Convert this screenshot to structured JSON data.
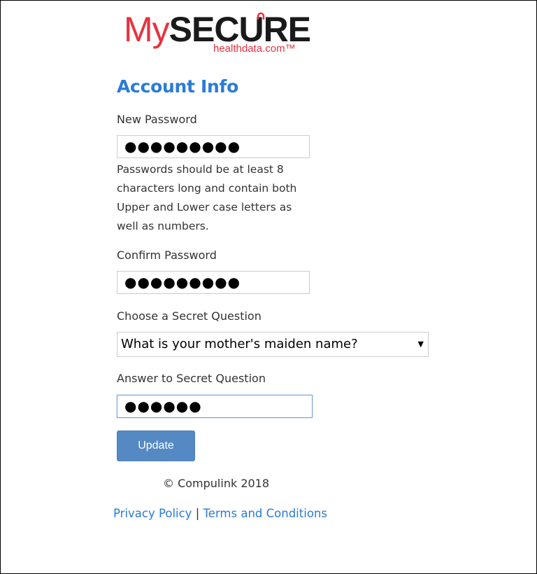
{
  "logo": {
    "part1": "My",
    "part2": "SECURE",
    "tagline": "healthdata.com™",
    "colors": {
      "red": "#e8323f",
      "dark": "#1a1a1a"
    }
  },
  "form": {
    "title": "Account Info",
    "new_password": {
      "label": "New Password",
      "value": "●●●●●●●●●"
    },
    "hint": "Passwords should be at least 8 characters long and contain both Upper and Lower case letters as well as numbers.",
    "confirm_password": {
      "label": "Confirm Password",
      "value": "●●●●●●●●●"
    },
    "secret_question": {
      "label": "Choose a Secret Question",
      "selected": "What is your mother's maiden name?",
      "arrow_icon": "dropdown-caret-icon"
    },
    "secret_answer": {
      "label": "Answer to Secret Question",
      "value": "●●●●●●"
    },
    "submit_label": "Update"
  },
  "footer": {
    "copyright": "© Compulink 2018",
    "privacy_link": "Privacy Policy",
    "separator": "|",
    "terms_link": "Terms and Conditions"
  },
  "colors": {
    "accent": "#2a7bd8",
    "button": "#5589c4"
  }
}
